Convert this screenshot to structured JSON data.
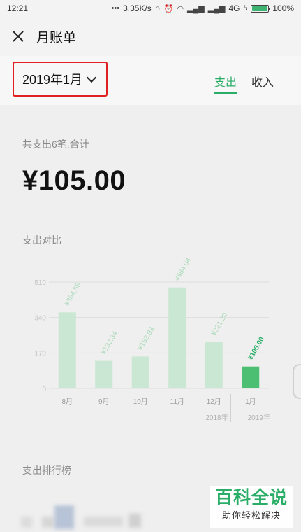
{
  "status_bar": {
    "time": "12:21",
    "dots": "•••",
    "speed": "3.35K/s",
    "network": "4G",
    "battery": "100%"
  },
  "header": {
    "title": "月账单"
  },
  "filter": {
    "month": "2019年1月",
    "tabs": [
      {
        "label": "支出",
        "active": true
      },
      {
        "label": "收入",
        "active": false
      }
    ]
  },
  "summary": {
    "label": "共支出6笔,合计",
    "amount": "¥105.00"
  },
  "sections": {
    "chart_title": "支出对比",
    "ranking_title": "支出排行榜"
  },
  "watermark": {
    "main": "百科全说",
    "sub": "助你轻松解决"
  },
  "colors": {
    "accent": "#2aae67",
    "bar": "#c9e7d2",
    "bar_active": "#4cbf73",
    "highlight_border": "#e02020"
  },
  "chart_data": {
    "type": "bar",
    "categories": [
      "8月",
      "9月",
      "10月",
      "11月",
      "12月",
      "1月"
    ],
    "years": [
      {
        "label": "2018年",
        "after_index": 4
      },
      {
        "label": "2019年",
        "after_index": 5
      }
    ],
    "values": [
      364.56,
      132.34,
      152.93,
      484.04,
      221.2,
      105.0
    ],
    "value_labels": [
      "¥364.56",
      "¥132.34",
      "¥152.93",
      "¥484.04",
      "¥221.20",
      "¥105.00"
    ],
    "active_index": 5,
    "yticks": [
      "0",
      "170",
      "340",
      "510"
    ],
    "ylim": [
      0,
      510
    ],
    "grid": true
  }
}
